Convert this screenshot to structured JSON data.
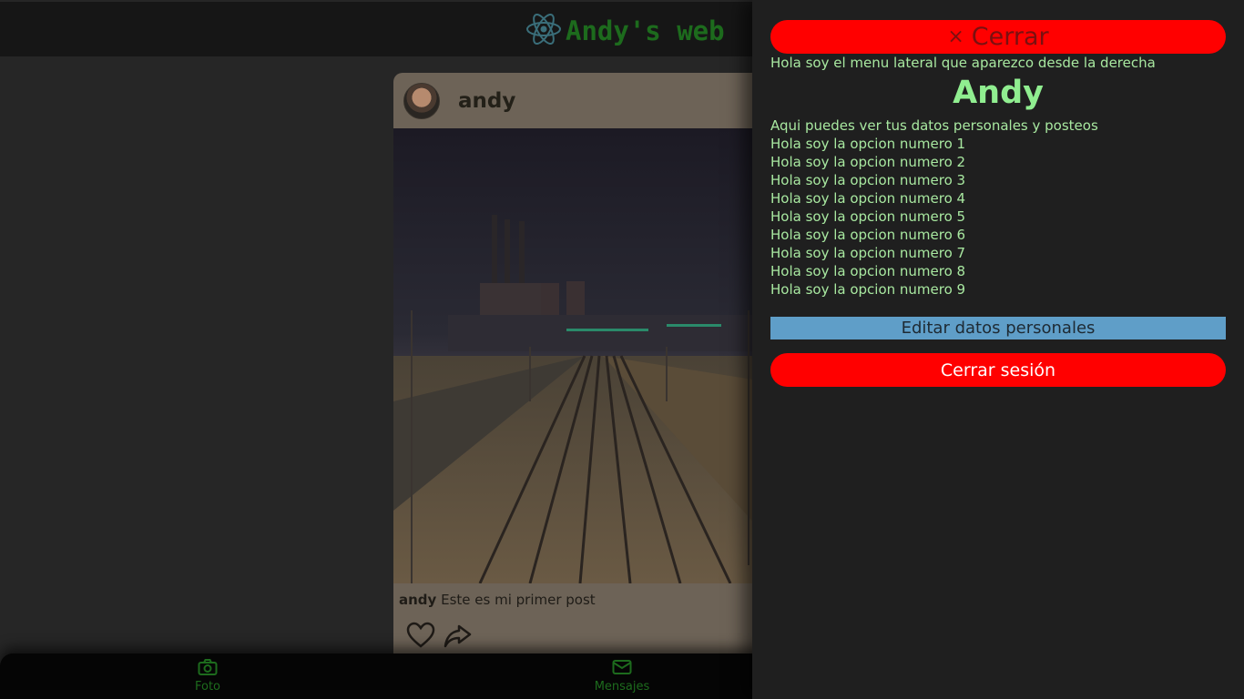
{
  "header": {
    "title": "Andy's web",
    "logo_icon": "react-atom-icon"
  },
  "post": {
    "username": "andy",
    "caption_user": "andy",
    "caption_text": "Este es mi primer post",
    "image_alt_icon": "railway-night-photo",
    "like_icon": "heart-icon",
    "share_icon": "share-icon"
  },
  "bottom_nav": {
    "items": [
      {
        "label": "Foto",
        "icon": "camera-icon"
      },
      {
        "label": "Mensajes",
        "icon": "envelope-icon"
      }
    ]
  },
  "side_panel": {
    "close_label": "Cerrar",
    "close_symbol": "×",
    "intro": "Hola soy el menu lateral que aparezco desde la derecha",
    "name": "Andy",
    "description": "Aqui puedes ver tus datos personales y posteos",
    "options": [
      "Hola soy la opcion numero 1",
      "Hola soy la opcion numero 2",
      "Hola soy la opcion numero 3",
      "Hola soy la opcion numero 4",
      "Hola soy la opcion numero 5",
      "Hola soy la opcion numero 6",
      "Hola soy la opcion numero 7",
      "Hola soy la opcion numero 8",
      "Hola soy la opcion numero 9"
    ],
    "edit_label": "Editar datos personales",
    "logout_label": "Cerrar sesión"
  },
  "colors": {
    "brand_green": "#1d6b1d",
    "panel_text": "#a8e8a0",
    "danger_red": "#ff0000",
    "edit_blue": "#5f9ec8"
  }
}
